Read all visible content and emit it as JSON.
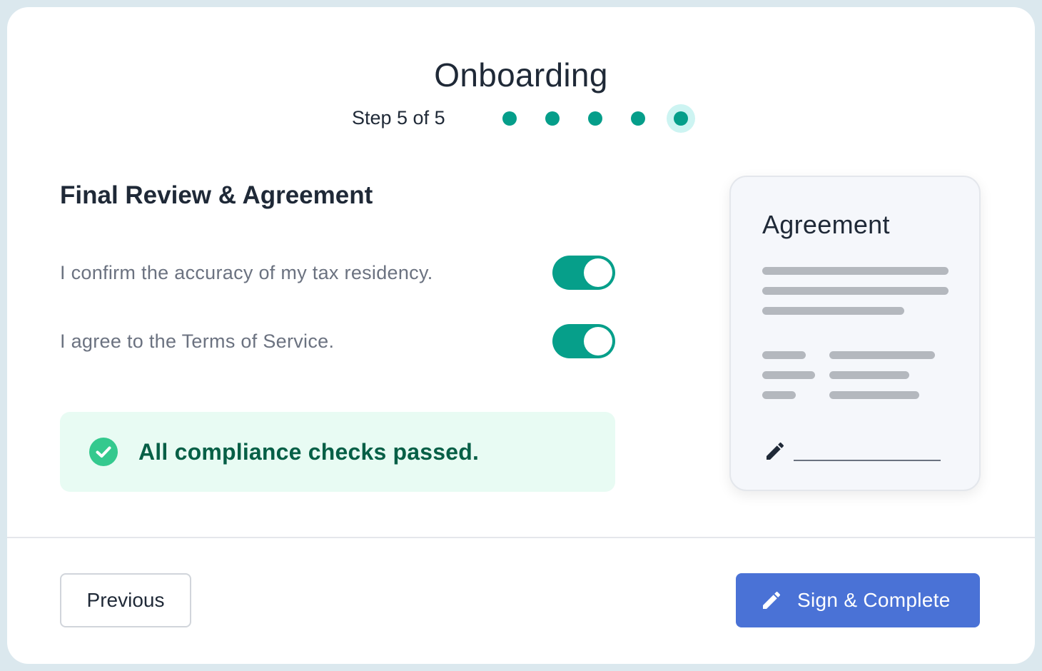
{
  "header": {
    "title": "Onboarding",
    "step_text": "Step 5 of 5",
    "steps_total": 5,
    "current_step": 5
  },
  "section": {
    "title": "Final Review & Agreement",
    "items": [
      {
        "label": "I confirm the accuracy of my tax residency.",
        "checked": true
      },
      {
        "label": "I agree to the Terms of Service.",
        "checked": true
      }
    ]
  },
  "alert": {
    "message": "All compliance checks passed.",
    "icon": "check-circle-icon"
  },
  "agreement_card": {
    "title": "Agreement",
    "icon": "pencil-icon"
  },
  "footer": {
    "previous_label": "Previous",
    "sign_label": "Sign & Complete",
    "sign_icon": "pencil-icon"
  },
  "colors": {
    "accent_teal": "#069f8a",
    "primary_button": "#4a72d6",
    "success_bg": "#e8fbf3",
    "success_text": "#065f46",
    "success_icon": "#34c98e"
  }
}
